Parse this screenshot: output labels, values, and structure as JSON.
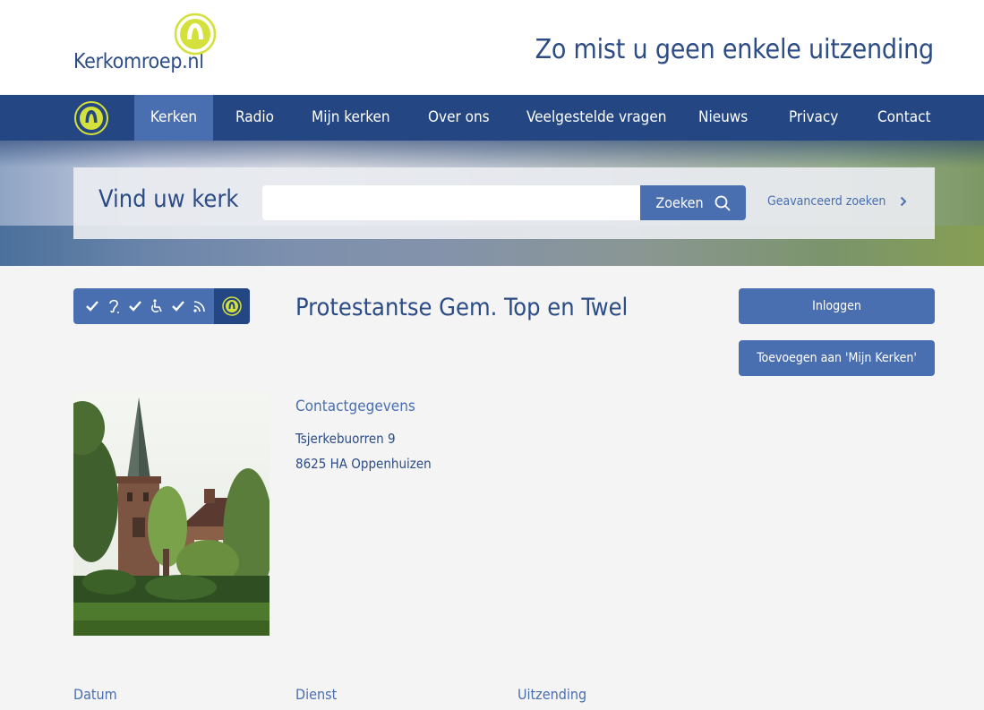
{
  "header": {
    "logo_text": "Kerkomroep.nl",
    "logo_icon": "broadcast-icon",
    "tagline": "Zo mist u geen enkele uitzending"
  },
  "nav": {
    "items": [
      {
        "label": "Kerken",
        "active": true
      },
      {
        "label": "Radio",
        "active": false
      },
      {
        "label": "Mijn kerken",
        "active": false
      },
      {
        "label": "Over ons",
        "active": false
      },
      {
        "label": "Veelgestelde vragen",
        "active": false
      },
      {
        "label": "Nieuws",
        "active": false
      },
      {
        "label": "Privacy",
        "active": false
      },
      {
        "label": "Contact",
        "active": false
      }
    ]
  },
  "search": {
    "title": "Vind uw kerk",
    "input_value": "",
    "input_placeholder": "",
    "button_label": "Zoeken",
    "advanced_label": "Geavanceerd zoeken"
  },
  "church": {
    "features": [
      "check-icon",
      "hearing-icon",
      "check-icon",
      "wheelchair-icon",
      "check-icon",
      "rss-icon",
      "broadcast-icon"
    ],
    "name": "Protestantse Gem. Top en Twel",
    "login_label": "Inloggen",
    "add_label": "Toevoegen aan 'Mijn Kerken'",
    "contact": {
      "heading": "Contactgegevens",
      "street": "Tsjerkebuorren 9",
      "city": "8625 HA Oppenhuizen"
    }
  },
  "table": {
    "columns": [
      "Datum",
      "Dienst",
      "Uitzending"
    ]
  },
  "colors": {
    "primary": "#244784",
    "accent": "#4a6fb0",
    "logo_yellow": "#d4e03b",
    "background": "#f4f4f4"
  }
}
